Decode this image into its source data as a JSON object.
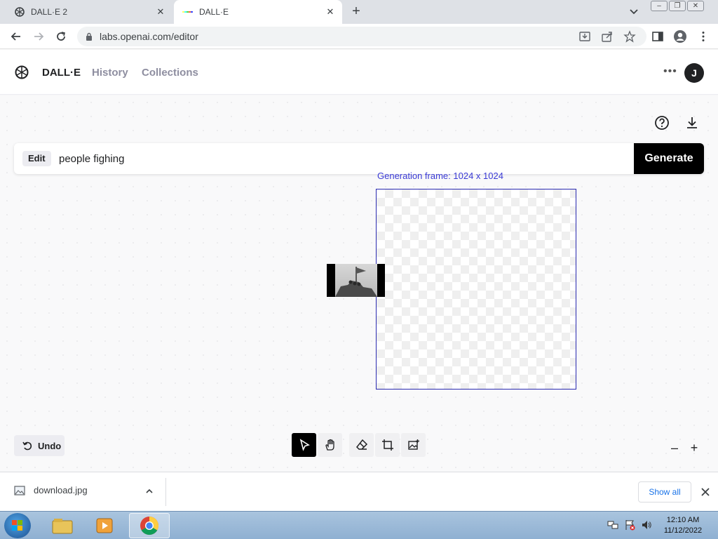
{
  "browser": {
    "tabs": [
      {
        "title": "DALL·E 2",
        "active": false,
        "icon": "openai-logo-icon"
      },
      {
        "title": "DALL·E",
        "active": true,
        "icon": "dalle-color-bar-icon"
      }
    ],
    "url": "labs.openai.com/editor"
  },
  "app": {
    "brand": "DALL·E",
    "nav": {
      "history": "History",
      "collections": "Collections"
    },
    "avatar_initial": "J"
  },
  "editor": {
    "edit_chip": "Edit",
    "prompt_value": "people fighing",
    "generate_label": "Generate",
    "frame_label": "Generation frame: 1024 x 1024",
    "undo_label": "Undo",
    "tools": [
      "select-icon",
      "hand-icon",
      "eraser-icon",
      "add-frame-icon",
      "upload-image-icon"
    ],
    "active_tool": "select-icon"
  },
  "downloads": {
    "file": "download.jpg",
    "show_all": "Show all"
  },
  "taskbar": {
    "apps": [
      "explorer-icon",
      "media-player-icon",
      "chrome-icon"
    ],
    "time": "12:10 AM",
    "date": "11/12/2022"
  },
  "colors": {
    "accent": "#000000",
    "frame": "#2a2ab0",
    "link": "#1a73e8"
  }
}
